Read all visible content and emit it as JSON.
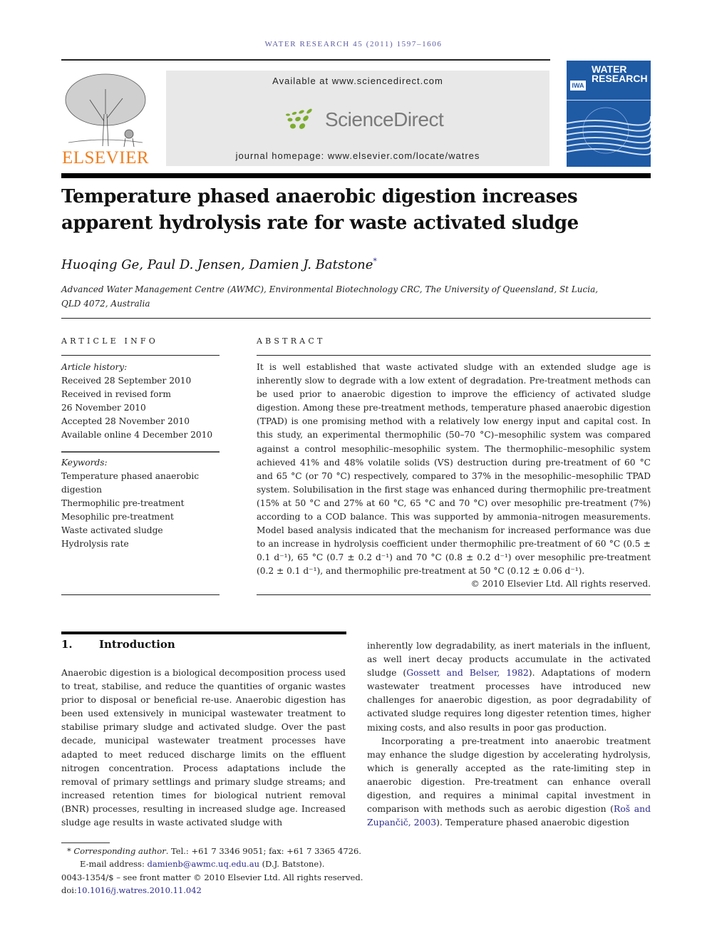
{
  "header": {
    "running_head": "WATER RESEARCH 45 (2011) 1597–1606",
    "publisher_logo": "ELSEVIER",
    "available_at": "Available at www.sciencedirect.com",
    "sciencedirect_logo": "ScienceDirect",
    "journal_homepage": "journal homepage: www.elsevier.com/locate/watres",
    "cover": {
      "badge": "IWA",
      "title_line1": "WATER",
      "title_line2": "RESEARCH"
    },
    "colors": {
      "elsevier_orange": "#f07e1e",
      "sciencedirect_green": "#7cac2c",
      "cover_blue": "#1f5aa5",
      "link_blue": "#2c2c8c"
    }
  },
  "article": {
    "title": "Temperature phased anaerobic digestion increases apparent hydrolysis rate for waste activated sludge",
    "authors": "Huoqing Ge, Paul D. Jensen, Damien J. Batstone",
    "corresponding_mark": "*",
    "affiliation_line1": "Advanced Water Management Centre (AWMC), Environmental Biotechnology CRC, The University of Queensland, St Lucia,",
    "affiliation_line2": "QLD 4072, Australia"
  },
  "article_info": {
    "heading": "ARTICLE INFO",
    "history_label": "Article history:",
    "history": [
      "Received 28 September 2010",
      "Received in revised form",
      "26 November 2010",
      "Accepted 28 November 2010",
      "Available online 4 December 2010"
    ],
    "keywords_label": "Keywords:",
    "keywords": [
      "Temperature phased anaerobic",
      "digestion",
      "Thermophilic pre-treatment",
      "Mesophilic pre-treatment",
      "Waste activated sludge",
      "Hydrolysis rate"
    ]
  },
  "abstract": {
    "heading": "ABSTRACT",
    "text": "It is well established that waste activated sludge with an extended sludge age is inherently slow to degrade with a low extent of degradation. Pre-treatment methods can be used prior to anaerobic digestion to improve the efficiency of activated sludge digestion. Among these pre-treatment methods, temperature phased anaerobic digestion (TPAD) is one promising method with a relatively low energy input and capital cost. In this study, an experimental thermophilic (50–70 °C)–mesophilic system was compared against a control mesophilic–mesophilic system. The thermophilic–mesophilic system achieved 41% and 48% volatile solids (VS) destruction during pre-treatment of 60 °C and 65 °C (or 70 °C) respectively, compared to 37% in the mesophilic–mesophilic TPAD system. Solubilisation in the first stage was enhanced during thermophilic pre-treatment (15% at 50 °C and 27% at 60 °C, 65 °C and 70 °C) over mesophilic pre-treatment (7%) according to a COD balance. This was supported by ammonia–nitrogen measurements. Model based analysis indicated that the mechanism for increased performance was due to an increase in hydrolysis coefficient under thermophilic pre-treatment of 60 °C (0.5 ± 0.1 d⁻¹), 65 °C (0.7 ± 0.2 d⁻¹) and 70 °C (0.8 ± 0.2 d⁻¹) over mesophilic pre-treatment (0.2 ± 0.1 d⁻¹), and thermophilic pre-treatment at 50 °C (0.12 ± 0.06 d⁻¹).",
    "copyright": "© 2010 Elsevier Ltd. All rights reserved."
  },
  "introduction": {
    "number": "1.",
    "heading": "Introduction",
    "left_para": "Anaerobic digestion is a biological decomposition process used to treat, stabilise, and reduce the quantities of organic wastes prior to disposal or beneficial re-use. Anaerobic digestion has been used extensively in municipal wastewater treatment to stabilise primary sludge and activated sludge. Over the past decade, municipal wastewater treatment processes have adapted to meet reduced discharge limits on the effluent nitrogen concentration. Process adaptations include the removal of primary settlings and primary sludge streams; and increased retention times for biological nutrient removal (BNR) processes, resulting in increased sludge age. Increased sludge age results in waste activated sludge with",
    "right_para1_a": "inherently low degradability, as inert materials in the influent, as well inert decay products accumulate in the activated sludge (",
    "right_para1_ref": "Gossett and Belser, 1982",
    "right_para1_b": "). Adaptations of modern wastewater treatment processes have introduced new challenges for anaerobic digestion, as poor degradability of activated sludge requires long digester retention times, higher mixing costs, and also results in poor gas production.",
    "right_para2_a": "Incorporating a pre-treatment into anaerobic treatment may enhance the sludge digestion by accelerating hydrolysis, which is generally accepted as the rate-limiting step in anaerobic digestion. Pre-treatment can enhance overall digestion, and requires a minimal capital investment in comparison with methods such as aerobic digestion (",
    "right_para2_ref": "Roš and Zupančič, 2003",
    "right_para2_b": "). Temperature phased anaerobic digestion"
  },
  "footnotes": {
    "mark": "*",
    "corresponding_label": "Corresponding author",
    "contact": ". Tel.: +61 7 3346 9051; fax: +61 7 3365 4726.",
    "email_label": "E-mail address: ",
    "email": "damienb@awmc.uq.edu.au",
    "email_suffix": " (D.J. Batstone).",
    "front_matter": "0043-1354/$ – see front matter © 2010 Elsevier Ltd. All rights reserved.",
    "doi_label": "doi:",
    "doi": "10.1016/j.watres.2010.11.042"
  }
}
